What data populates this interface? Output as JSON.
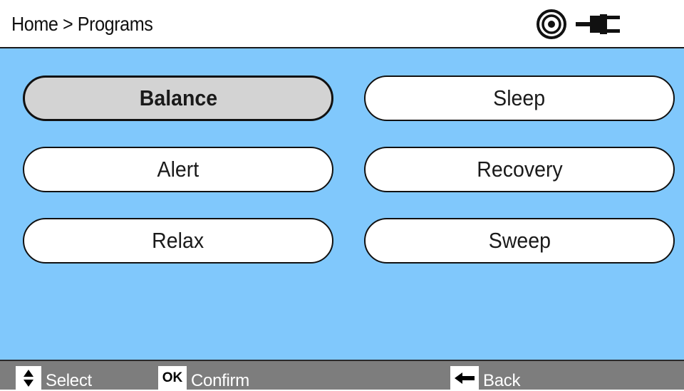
{
  "header": {
    "breadcrumb": "Home > Programs",
    "status_icons": [
      "target-icon",
      "plug-icon"
    ]
  },
  "programs": [
    {
      "label": "Balance",
      "selected": true
    },
    {
      "label": "Sleep",
      "selected": false
    },
    {
      "label": "Alert",
      "selected": false
    },
    {
      "label": "Recovery",
      "selected": false
    },
    {
      "label": "Relax",
      "selected": false
    },
    {
      "label": "Sweep",
      "selected": false
    }
  ],
  "footer": {
    "select_icon": "up-down-arrows-icon",
    "select_label": "Select",
    "confirm_key": "OK",
    "confirm_label": "Confirm",
    "back_icon": "left-arrow-icon",
    "back_label": "Back"
  },
  "colors": {
    "main_background": "#80c8fc",
    "footer_background": "#7d7d7d",
    "selected_button": "#d3d3d3",
    "button": "#ffffff"
  }
}
